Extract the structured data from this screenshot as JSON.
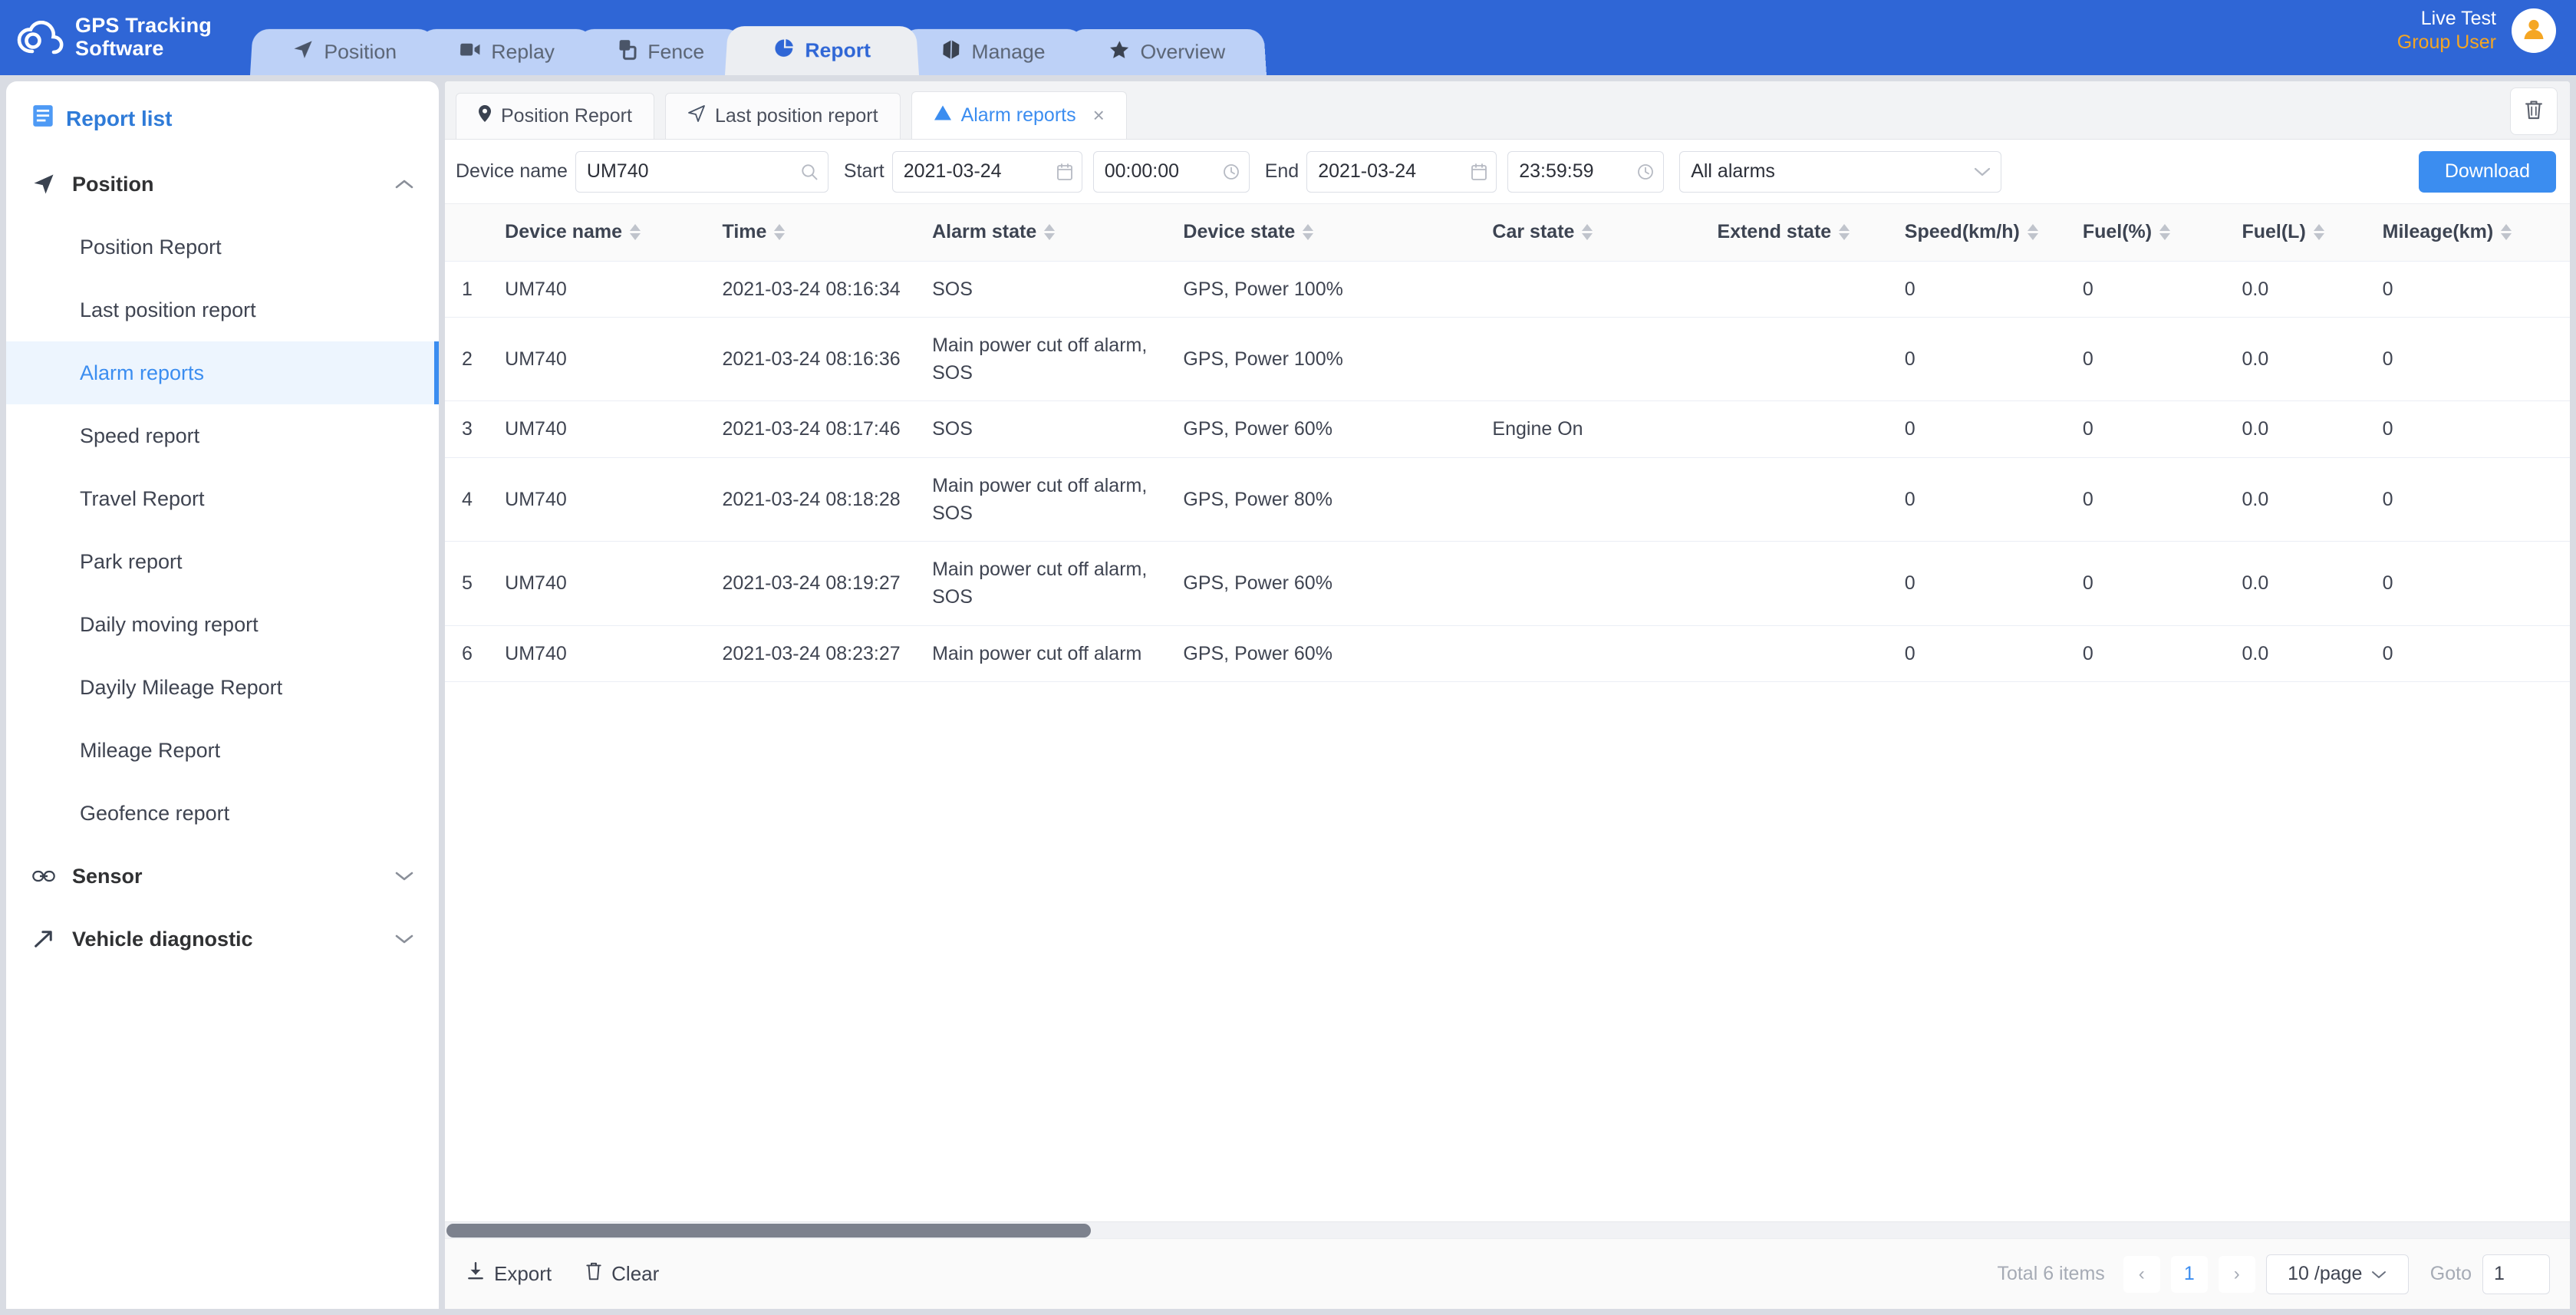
{
  "brand": {
    "line1": "GPS Tracking",
    "line2": "Software",
    "logo_icon": "cloud-icon"
  },
  "topnav": {
    "items": [
      {
        "label": "Position",
        "icon": "paper-plane-icon",
        "active": false
      },
      {
        "label": "Replay",
        "icon": "video-camera-icon",
        "active": false
      },
      {
        "label": "Fence",
        "icon": "fence-icon",
        "active": false
      },
      {
        "label": "Report",
        "icon": "pie-chart-icon",
        "active": true
      },
      {
        "label": "Manage",
        "icon": "cube-icon",
        "active": false
      },
      {
        "label": "Overview",
        "icon": "star-icon",
        "active": false
      }
    ]
  },
  "user": {
    "name": "Live Test",
    "role": "Group User",
    "avatar_icon": "user-avatar-icon",
    "role_color": "#f5a623"
  },
  "sidebar": {
    "header": {
      "label": "Report list",
      "icon": "document-list-icon"
    },
    "groups": [
      {
        "label": "Position",
        "icon": "paper-plane-icon",
        "expanded": true,
        "chevron": "chevron-up-icon",
        "items": [
          {
            "label": "Position Report",
            "active": false
          },
          {
            "label": "Last position report",
            "active": false
          },
          {
            "label": "Alarm reports",
            "active": true
          },
          {
            "label": "Speed report",
            "active": false
          },
          {
            "label": "Travel Report",
            "active": false
          },
          {
            "label": "Park report",
            "active": false
          },
          {
            "label": "Daily moving report",
            "active": false
          },
          {
            "label": "Dayily Mileage Report",
            "active": false
          },
          {
            "label": "Mileage Report",
            "active": false
          },
          {
            "label": "Geofence report",
            "active": false
          }
        ]
      },
      {
        "label": "Sensor",
        "icon": "link-icon",
        "expanded": false,
        "chevron": "chevron-down-icon",
        "items": []
      },
      {
        "label": "Vehicle diagnostic",
        "icon": "wrench-arrow-icon",
        "expanded": false,
        "chevron": "chevron-down-icon",
        "items": []
      }
    ]
  },
  "subtabs": {
    "items": [
      {
        "label": "Position Report",
        "icon": "map-pin-icon",
        "active": false,
        "closable": false
      },
      {
        "label": "Last position report",
        "icon": "paper-plane-icon",
        "active": false,
        "closable": false
      },
      {
        "label": "Alarm reports",
        "icon": "warning-triangle-icon",
        "active": true,
        "closable": true
      }
    ],
    "close_glyph": "×",
    "trash_icon": "trash-icon"
  },
  "filters": {
    "device_label": "Device name",
    "device_value": "UM740",
    "device_placeholder": "Device name",
    "search_icon": "search-icon",
    "start_label": "Start",
    "start_date": "2021-03-24",
    "start_time": "00:00:00",
    "end_label": "End",
    "end_date": "2021-03-24",
    "end_time": "23:59:59",
    "calendar_icon": "calendar-icon",
    "clock_icon": "clock-icon",
    "alarm_type": "All alarms",
    "alarm_chevron": "chevron-down-icon",
    "download_label": "Download",
    "accent_color": "#3b8df0"
  },
  "table": {
    "columns": [
      {
        "key": "idx",
        "label": "",
        "sortable": false
      },
      {
        "key": "device",
        "label": "Device name",
        "sortable": true
      },
      {
        "key": "time",
        "label": "Time",
        "sortable": true
      },
      {
        "key": "alarm",
        "label": "Alarm state",
        "sortable": true
      },
      {
        "key": "devstate",
        "label": "Device state",
        "sortable": true
      },
      {
        "key": "car",
        "label": "Car state",
        "sortable": true
      },
      {
        "key": "ext",
        "label": "Extend state",
        "sortable": true
      },
      {
        "key": "speed",
        "label": "Speed(km/h)",
        "sortable": true
      },
      {
        "key": "fuelp",
        "label": "Fuel(%)",
        "sortable": true
      },
      {
        "key": "fuell",
        "label": "Fuel(L)",
        "sortable": true
      },
      {
        "key": "mile",
        "label": "Mileage(km)",
        "sortable": true
      }
    ],
    "rows": [
      {
        "idx": "1",
        "device": "UM740",
        "time": "2021-03-24 08:16:34",
        "alarm": "SOS",
        "devstate": "GPS, Power 100%",
        "car": "",
        "ext": "",
        "speed": "0",
        "fuelp": "0",
        "fuell": "0.0",
        "mile": "0"
      },
      {
        "idx": "2",
        "device": "UM740",
        "time": "2021-03-24 08:16:36",
        "alarm": "Main power cut off alarm, SOS",
        "devstate": "GPS, Power 100%",
        "car": "",
        "ext": "",
        "speed": "0",
        "fuelp": "0",
        "fuell": "0.0",
        "mile": "0"
      },
      {
        "idx": "3",
        "device": "UM740",
        "time": "2021-03-24 08:17:46",
        "alarm": "SOS",
        "devstate": "GPS, Power 60%",
        "car": "Engine On",
        "ext": "",
        "speed": "0",
        "fuelp": "0",
        "fuell": "0.0",
        "mile": "0"
      },
      {
        "idx": "4",
        "device": "UM740",
        "time": "2021-03-24 08:18:28",
        "alarm": "Main power cut off alarm, SOS",
        "devstate": "GPS, Power 80%",
        "car": "",
        "ext": "",
        "speed": "0",
        "fuelp": "0",
        "fuell": "0.0",
        "mile": "0"
      },
      {
        "idx": "5",
        "device": "UM740",
        "time": "2021-03-24 08:19:27",
        "alarm": "Main power cut off alarm, SOS",
        "devstate": "GPS, Power 60%",
        "car": "",
        "ext": "",
        "speed": "0",
        "fuelp": "0",
        "fuell": "0.0",
        "mile": "0"
      },
      {
        "idx": "6",
        "device": "UM740",
        "time": "2021-03-24 08:23:27",
        "alarm": "Main power cut off alarm",
        "devstate": "GPS, Power 60%",
        "car": "",
        "ext": "",
        "speed": "0",
        "fuelp": "0",
        "fuell": "0.0",
        "mile": "0"
      }
    ]
  },
  "footer": {
    "export_label": "Export",
    "export_icon": "download-icon",
    "clear_label": "Clear",
    "clear_icon": "trash-icon",
    "total_text": "Total 6 items",
    "prev_glyph": "‹",
    "next_glyph": "›",
    "current_page": "1",
    "page_size": "10 /page",
    "page_size_chevron": "chevron-down-icon",
    "goto_label": "Goto",
    "goto_value": "1"
  }
}
